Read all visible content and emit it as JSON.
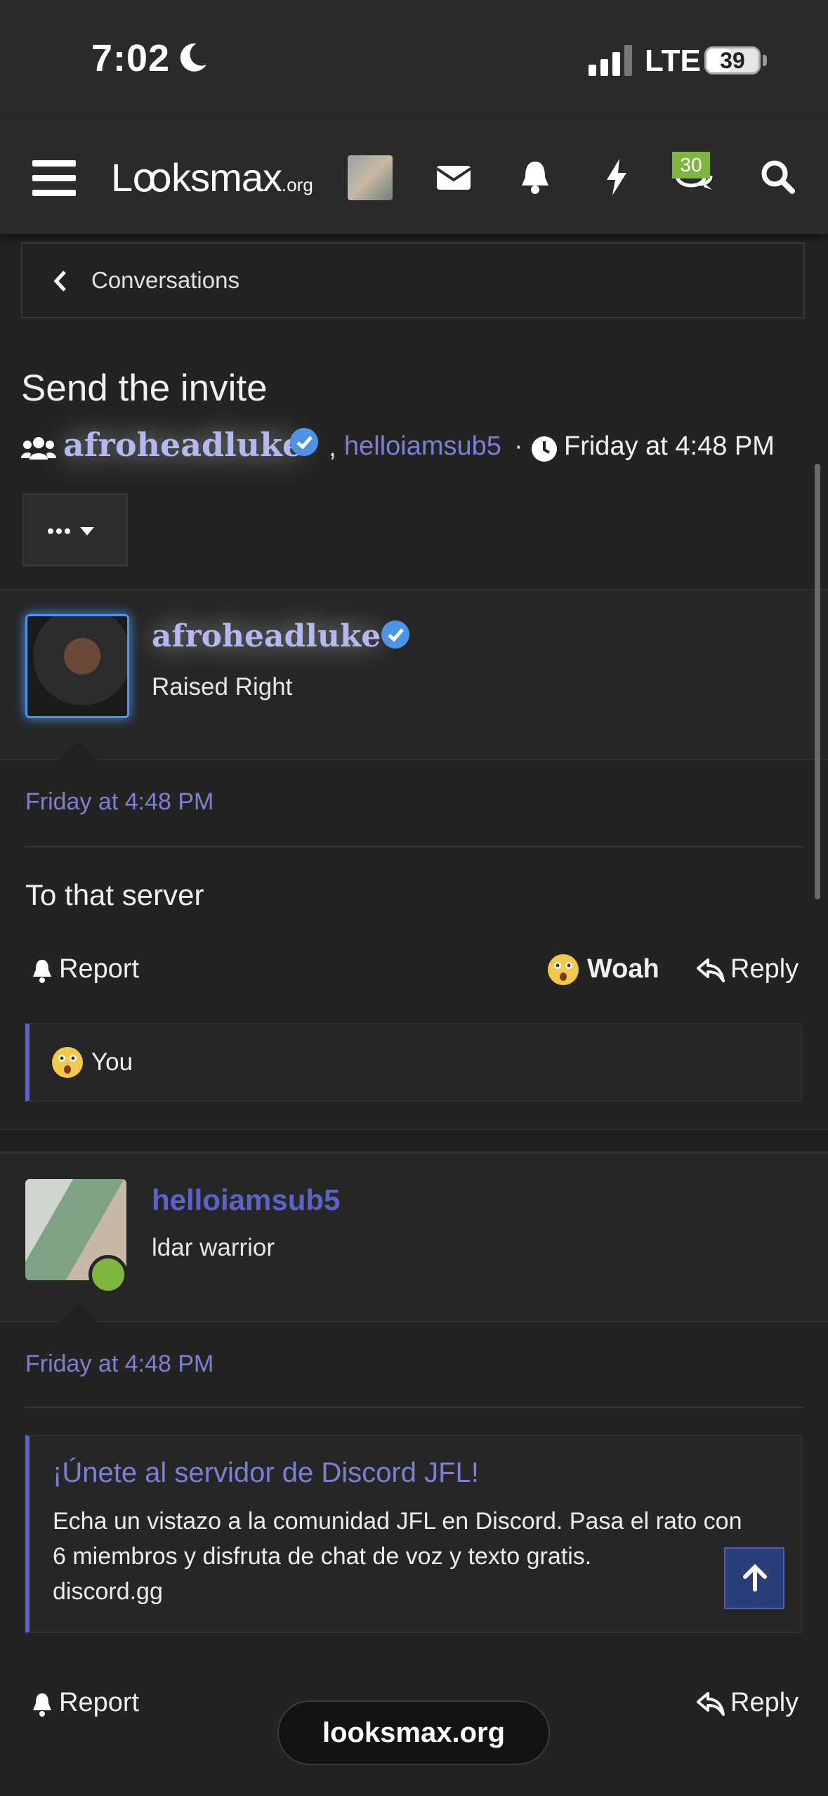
{
  "status_bar": {
    "time": "7:02",
    "network": "LTE",
    "battery": "39"
  },
  "nav": {
    "logo_main": "Lꝏksmax",
    "logo_suffix": ".org",
    "conversations_badge": "30"
  },
  "breadcrumb": {
    "label": "Conversations"
  },
  "thread": {
    "title": "Send the invite",
    "participant_1": "afroheadluke",
    "separator": ",",
    "participant_2": "helloiamsub5",
    "dot": "·",
    "date": "Friday at 4:48 PM"
  },
  "messages": [
    {
      "author": "afroheadluke",
      "user_title": "Raised Right",
      "date": "Friday at 4:48 PM",
      "body": "To that server",
      "report_label": "Report",
      "reaction_label": "Woah",
      "reply_label": "Reply",
      "reacted_by": "You"
    },
    {
      "author": "helloiamsub5",
      "user_title": "ldar warrior",
      "date": "Friday at 4:48 PM",
      "embed": {
        "title": "¡Únete al servidor de Discord JFL!",
        "description": "Echa un vistazo a la comunidad JFL en Discord. Pasa el rato con 6 miembros y disfruta de chat de voz y texto gratis.",
        "domain": "discord.gg"
      },
      "report_label": "Report",
      "reply_label": "Reply"
    }
  ],
  "browser": {
    "url": "looksmax.org"
  },
  "colors": {
    "accent": "#7a80d4",
    "verified": "#4c94e8",
    "online": "#7fb640",
    "background": "#232324"
  }
}
